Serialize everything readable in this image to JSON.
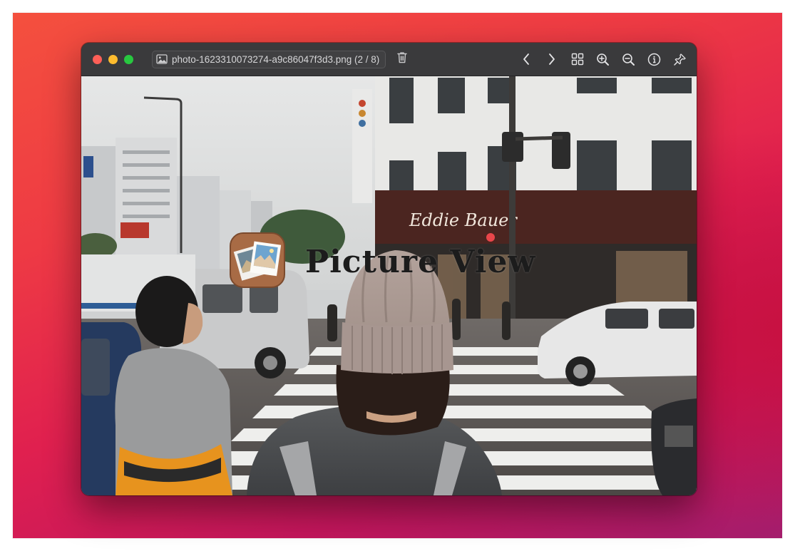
{
  "window": {
    "file_name": "photo-1623310073274-a9c86047f3d3.png (2 / 8)",
    "overlay_title": "Picture View"
  },
  "icons": {
    "close": "close-dot",
    "minimize": "minimize-dot",
    "zoom": "zoom-dot",
    "file": "image-icon",
    "trash": "trash-icon",
    "previous": "chevron-left-icon",
    "next": "chevron-right-icon",
    "grid": "grid-icon",
    "zoom_in": "zoom-in-icon",
    "zoom_out": "zoom-out-icon",
    "info": "info-icon",
    "pin": "pin-icon"
  },
  "colors": {
    "close": "#fe5f57",
    "minimize": "#febc2e",
    "zoom": "#28c840",
    "toolbar": "#3a3a3c",
    "desktop_top": "#f4503e",
    "desktop_bottom": "#a41d6c"
  }
}
